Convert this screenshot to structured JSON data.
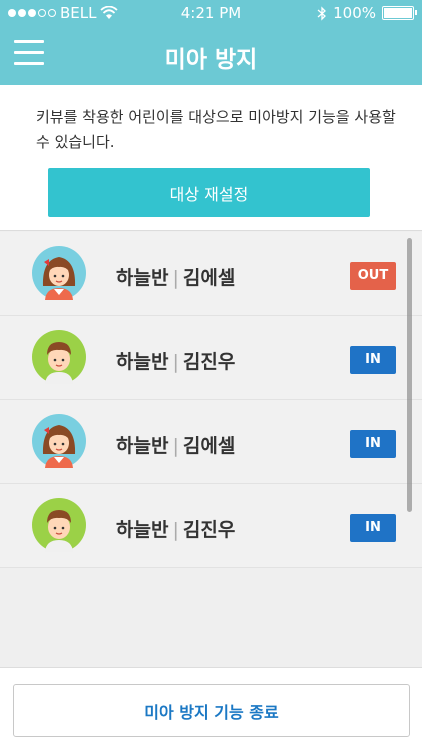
{
  "status_bar": {
    "carrier": "BELL",
    "time": "4:21 PM",
    "battery": "100%"
  },
  "header": {
    "title": "미아 방지",
    "menu_icon": "hamburger-menu-icon",
    "color": "#6cc9d4"
  },
  "description": {
    "text": "키뷰를 착용한 어린이를 대상으로 미아방지 기능을 사용할 수 있습니다.",
    "reset_button": "대상 재설정"
  },
  "children": [
    {
      "class_name": "하늘반",
      "separator": "|",
      "child_name": "김에셀",
      "status": "OUT",
      "status_color": "#e4624a",
      "avatar": "girl-avatar-icon"
    },
    {
      "class_name": "하늘반",
      "separator": "|",
      "child_name": "김진우",
      "status": "IN",
      "status_color": "#1f73c6",
      "avatar": "boy-avatar-icon"
    },
    {
      "class_name": "하늘반",
      "separator": "|",
      "child_name": "김에셀",
      "status": "IN",
      "status_color": "#1f73c6",
      "avatar": "girl-avatar-icon"
    },
    {
      "class_name": "하늘반",
      "separator": "|",
      "child_name": "김진우",
      "status": "IN",
      "status_color": "#1f73c6",
      "avatar": "boy-avatar-icon"
    }
  ],
  "footer": {
    "end_button": "미아 방지 기능 종료"
  }
}
